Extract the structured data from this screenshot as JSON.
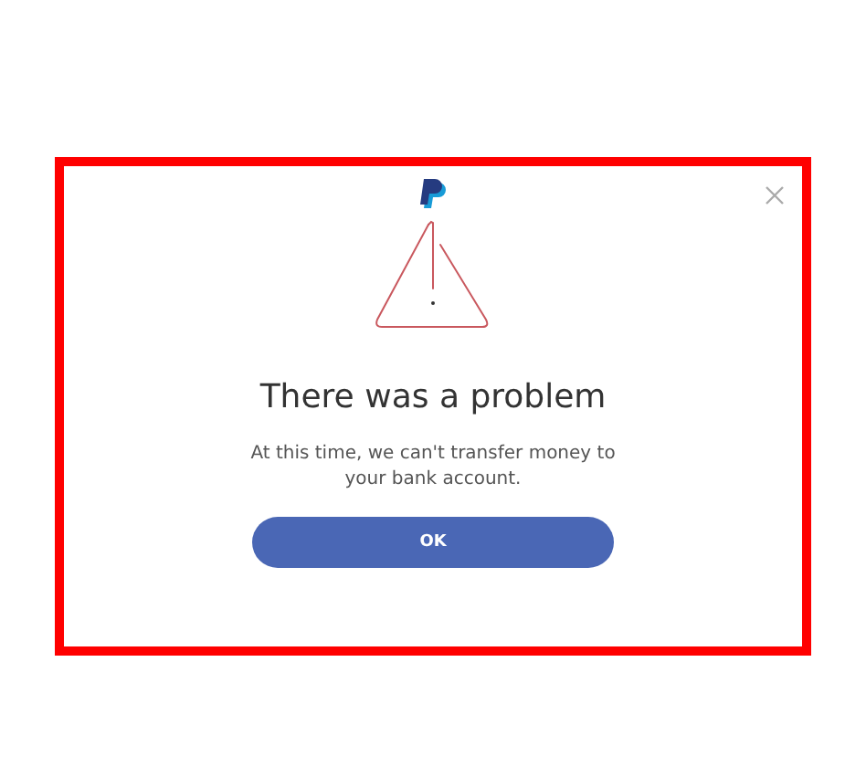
{
  "dialog": {
    "title": "There was a problem",
    "message": "At this time, we can't transfer money to your bank account.",
    "button": "OK"
  }
}
